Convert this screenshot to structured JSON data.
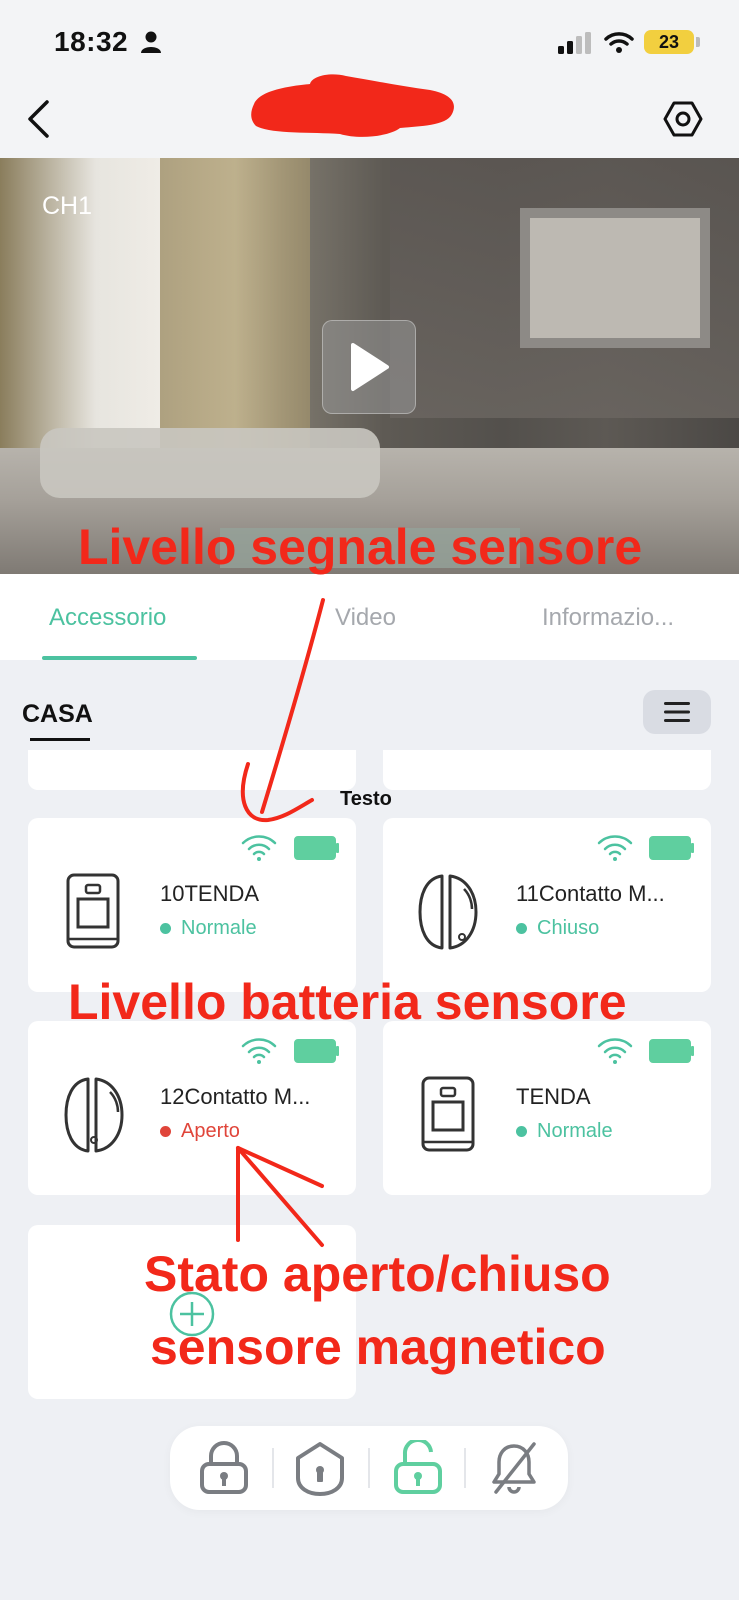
{
  "status_bar": {
    "time": "18:32",
    "battery_level": "23"
  },
  "video": {
    "channel_label": "CH1"
  },
  "tabs": [
    {
      "label": "Accessorio",
      "active": true
    },
    {
      "label": "Video",
      "active": false
    },
    {
      "label": "Informazio...",
      "active": false
    }
  ],
  "section": {
    "title": "CASA"
  },
  "testo_label": "Testo",
  "devices": [
    {
      "name": "10TENDA",
      "status": "Normale",
      "status_color": "#4cc2a0",
      "icon": "curtain-sensor-icon"
    },
    {
      "name": "11Contatto M...",
      "status": "Chiuso",
      "status_color": "#4cc2a0",
      "icon": "door-contact-icon"
    },
    {
      "name": "12Contatto M...",
      "status": "Aperto",
      "status_color": "#e0453a",
      "icon": "door-contact-icon"
    },
    {
      "name": "TENDA",
      "status": "Normale",
      "status_color": "#4cc2a0",
      "icon": "curtain-sensor-icon"
    }
  ],
  "annotations": {
    "signal": "Livello segnale sensore",
    "battery": "Livello batteria sensore",
    "state_line1": "Stato aperto/chiuso",
    "state_line2": "sensore magnetico"
  },
  "colors": {
    "accent": "#4cc2a0",
    "alert": "#e0453a",
    "annotation": "#f2281a",
    "redaction": "#f2281a"
  }
}
